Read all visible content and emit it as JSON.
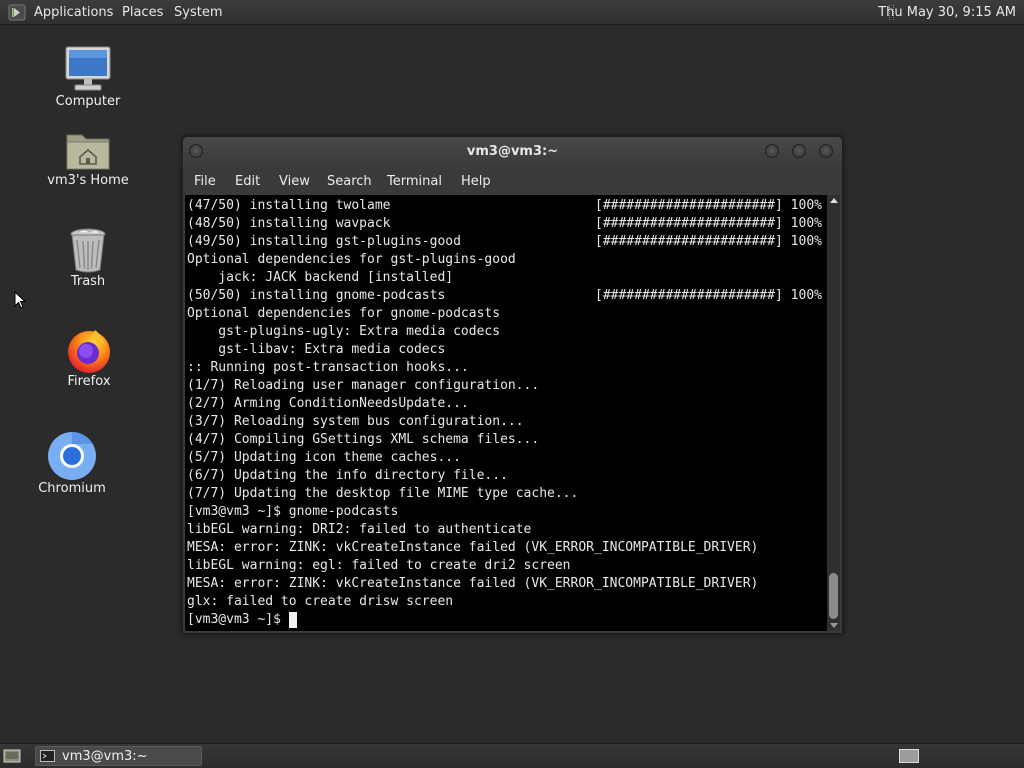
{
  "top_panel": {
    "menus": [
      "Applications",
      "Places",
      "System"
    ],
    "clock": "Thu May 30,  9:15 AM"
  },
  "desktop": {
    "icons": [
      {
        "label": "Computer",
        "icon": "computer-icon"
      },
      {
        "label": "vm3's Home",
        "icon": "home-folder-icon"
      },
      {
        "label": "Trash",
        "icon": "trash-icon"
      },
      {
        "label": "Firefox",
        "icon": "firefox-icon"
      },
      {
        "label": "Chromium",
        "icon": "chromium-icon"
      }
    ]
  },
  "terminal": {
    "title": "vm3@vm3:~",
    "menu": [
      "File",
      "Edit",
      "View",
      "Search",
      "Terminal",
      "Help"
    ],
    "lines": [
      {
        "text": "(47/50) installing twolame",
        "progress": "[######################] 100%"
      },
      {
        "text": "(48/50) installing wavpack",
        "progress": "[######################] 100%"
      },
      {
        "text": "(49/50) installing gst-plugins-good",
        "progress": "[######################] 100%"
      },
      {
        "text": "Optional dependencies for gst-plugins-good"
      },
      {
        "text": "    jack: JACK backend [installed]"
      },
      {
        "text": "(50/50) installing gnome-podcasts",
        "progress": "[######################] 100%"
      },
      {
        "text": "Optional dependencies for gnome-podcasts"
      },
      {
        "text": "    gst-plugins-ugly: Extra media codecs"
      },
      {
        "text": "    gst-libav: Extra media codecs"
      },
      {
        "text": ":: Running post-transaction hooks..."
      },
      {
        "text": "(1/7) Reloading user manager configuration..."
      },
      {
        "text": "(2/7) Arming ConditionNeedsUpdate..."
      },
      {
        "text": "(3/7) Reloading system bus configuration..."
      },
      {
        "text": "(4/7) Compiling GSettings XML schema files..."
      },
      {
        "text": "(5/7) Updating icon theme caches..."
      },
      {
        "text": "(6/7) Updating the info directory file..."
      },
      {
        "text": "(7/7) Updating the desktop file MIME type cache..."
      },
      {
        "text": "[vm3@vm3 ~]$ gnome-podcasts"
      },
      {
        "text": "libEGL warning: DRI2: failed to authenticate"
      },
      {
        "text": "MESA: error: ZINK: vkCreateInstance failed (VK_ERROR_INCOMPATIBLE_DRIVER)"
      },
      {
        "text": "libEGL warning: egl: failed to create dri2 screen"
      },
      {
        "text": "MESA: error: ZINK: vkCreateInstance failed (VK_ERROR_INCOMPATIBLE_DRIVER)"
      },
      {
        "text": "glx: failed to create drisw screen"
      },
      {
        "text": "[vm3@vm3 ~]$ "
      }
    ]
  },
  "taskbar": {
    "task_label": "vm3@vm3:~"
  },
  "colors": {
    "desktop_bg": "#2b2b2b",
    "terminal_bg": "#000000",
    "terminal_fg": "#e8e8e8"
  }
}
